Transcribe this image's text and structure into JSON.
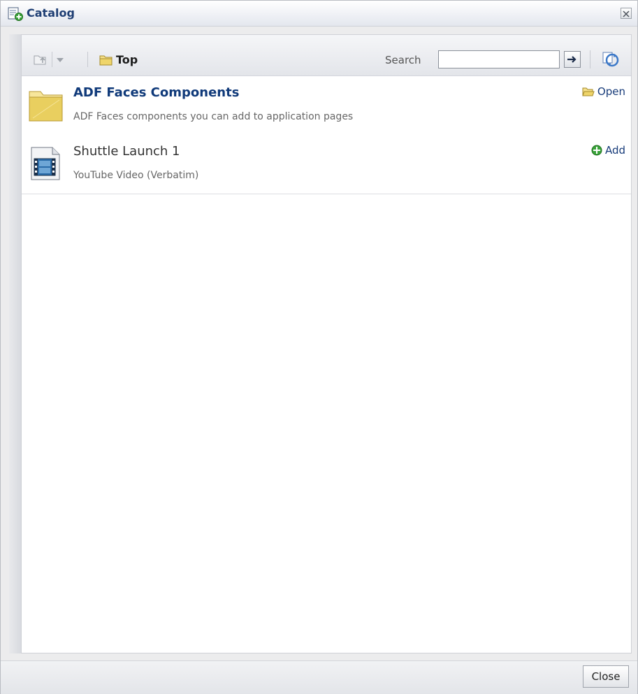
{
  "dialog": {
    "title": "Catalog",
    "close_icon": "close-icon"
  },
  "toolbar": {
    "up_icon": "up-level-icon",
    "dropdown_icon": "chevron-down-icon",
    "folder_icon": "folder-icon",
    "location": "Top",
    "search_label": "Search",
    "search_value": "",
    "search_go_icon": "arrow-right-icon",
    "refresh_icon": "refresh-icon"
  },
  "items": [
    {
      "title": "ADF Faces Components",
      "description": "ADF Faces components you can add to application pages",
      "action": "Open",
      "icon": "folder-icon",
      "action_icon": "open-folder-icon"
    },
    {
      "title": "Shuttle Launch 1",
      "description": "YouTube Video (Verbatim)",
      "action": "Add",
      "icon": "video-icon",
      "action_icon": "add-icon"
    }
  ],
  "footer": {
    "close_label": "Close"
  },
  "colors": {
    "title_text": "#1f3f74",
    "link": "#183c7a",
    "add_green": "#3aa33a",
    "folder_yellow": "#e8cf5e"
  }
}
